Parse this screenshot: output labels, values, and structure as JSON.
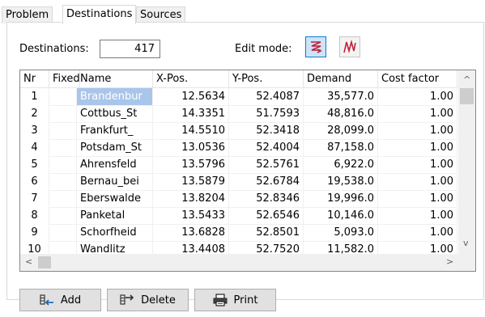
{
  "tabs": [
    {
      "label": "Problem"
    },
    {
      "label": "Destinations"
    },
    {
      "label": "Sources"
    }
  ],
  "destinations": {
    "label": "Destinations:",
    "value": "417"
  },
  "edit_mode": {
    "label": "Edit mode:"
  },
  "colors": {
    "accent": "#0a7ad9",
    "selection": "#a9c6ea",
    "mode_icon": "#c0203a"
  },
  "table": {
    "columns": [
      "Nr",
      "Fixed",
      "Name",
      "X-Pos.",
      "Y-Pos.",
      "Demand",
      "Cost factor"
    ],
    "rows": [
      {
        "nr": "1",
        "fixed": "",
        "name": "Brandenbur",
        "x": "12.5634",
        "y": "52.4087",
        "demand": "35,577.0",
        "cost": "1.00"
      },
      {
        "nr": "2",
        "fixed": "",
        "name": "Cottbus_St",
        "x": "14.3351",
        "y": "51.7593",
        "demand": "48,816.0",
        "cost": "1.00"
      },
      {
        "nr": "3",
        "fixed": "",
        "name": "Frankfurt_",
        "x": "14.5510",
        "y": "52.3418",
        "demand": "28,099.0",
        "cost": "1.00"
      },
      {
        "nr": "4",
        "fixed": "",
        "name": "Potsdam_St",
        "x": "13.0536",
        "y": "52.4004",
        "demand": "87,158.0",
        "cost": "1.00"
      },
      {
        "nr": "5",
        "fixed": "",
        "name": "Ahrensfeld",
        "x": "13.5796",
        "y": "52.5761",
        "demand": "6,922.0",
        "cost": "1.00"
      },
      {
        "nr": "6",
        "fixed": "",
        "name": "Bernau_bei",
        "x": "13.5879",
        "y": "52.6784",
        "demand": "19,538.0",
        "cost": "1.00"
      },
      {
        "nr": "7",
        "fixed": "",
        "name": "Eberswalde",
        "x": "13.8204",
        "y": "52.8346",
        "demand": "19,996.0",
        "cost": "1.00"
      },
      {
        "nr": "8",
        "fixed": "",
        "name": "Panketal",
        "x": "13.5433",
        "y": "52.6546",
        "demand": "10,146.0",
        "cost": "1.00"
      },
      {
        "nr": "9",
        "fixed": "",
        "name": "Schorfheid",
        "x": "13.6828",
        "y": "52.8501",
        "demand": "5,093.0",
        "cost": "1.00"
      },
      {
        "nr": "10",
        "fixed": "",
        "name": "Wandlitz",
        "x": "13.4408",
        "y": "52.7520",
        "demand": "11,582.0",
        "cost": "1.00"
      }
    ]
  },
  "buttons": {
    "add": "Add",
    "delete": "Delete",
    "print": "Print"
  },
  "scroll": {
    "up": "^",
    "down": "v",
    "left": "<",
    "right": ">"
  }
}
